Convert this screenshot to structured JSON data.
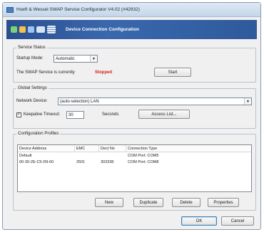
{
  "window": {
    "title": "Hoeft & Wessel SWAP Service Configurator V4.02 (#42932)"
  },
  "banner": {
    "title": "Device Connection Configuration"
  },
  "service_status": {
    "legend": "Service Status",
    "startup_mode_label": "Startup Mode:",
    "startup_mode_value": "Automatic",
    "state_label": "The SWAP Service is currently",
    "state_value": "Stopped",
    "start_button": "Start"
  },
  "global_settings": {
    "legend": "Global Settings",
    "network_device_label": "Network Device:",
    "network_device_value": "(auto-selection) LAN",
    "keepalive_checked": true,
    "keepalive_label": "Keepalive Timeout:",
    "keepalive_value": "30",
    "seconds_label": "Seconds",
    "access_list_button": "Access List..."
  },
  "profiles": {
    "legend": "Configuration Profiles",
    "columns": [
      "Device Address",
      "EMC",
      "Dect No",
      "Connection Type"
    ],
    "rows": [
      {
        "address": "Default",
        "emc": "",
        "dect": "",
        "type": "COM Port: COM5"
      },
      {
        "address": "00-30-2E-C5-D9-60",
        "emc": "2501",
        "dect": "303338",
        "type": "COM Port: COM8"
      }
    ],
    "new_button": "New",
    "duplicate_button": "Duplicate",
    "delete_button": "Delete",
    "properties_button": "Properties"
  },
  "footer": {
    "ok_button": "OK",
    "cancel_button": "Cancel"
  }
}
